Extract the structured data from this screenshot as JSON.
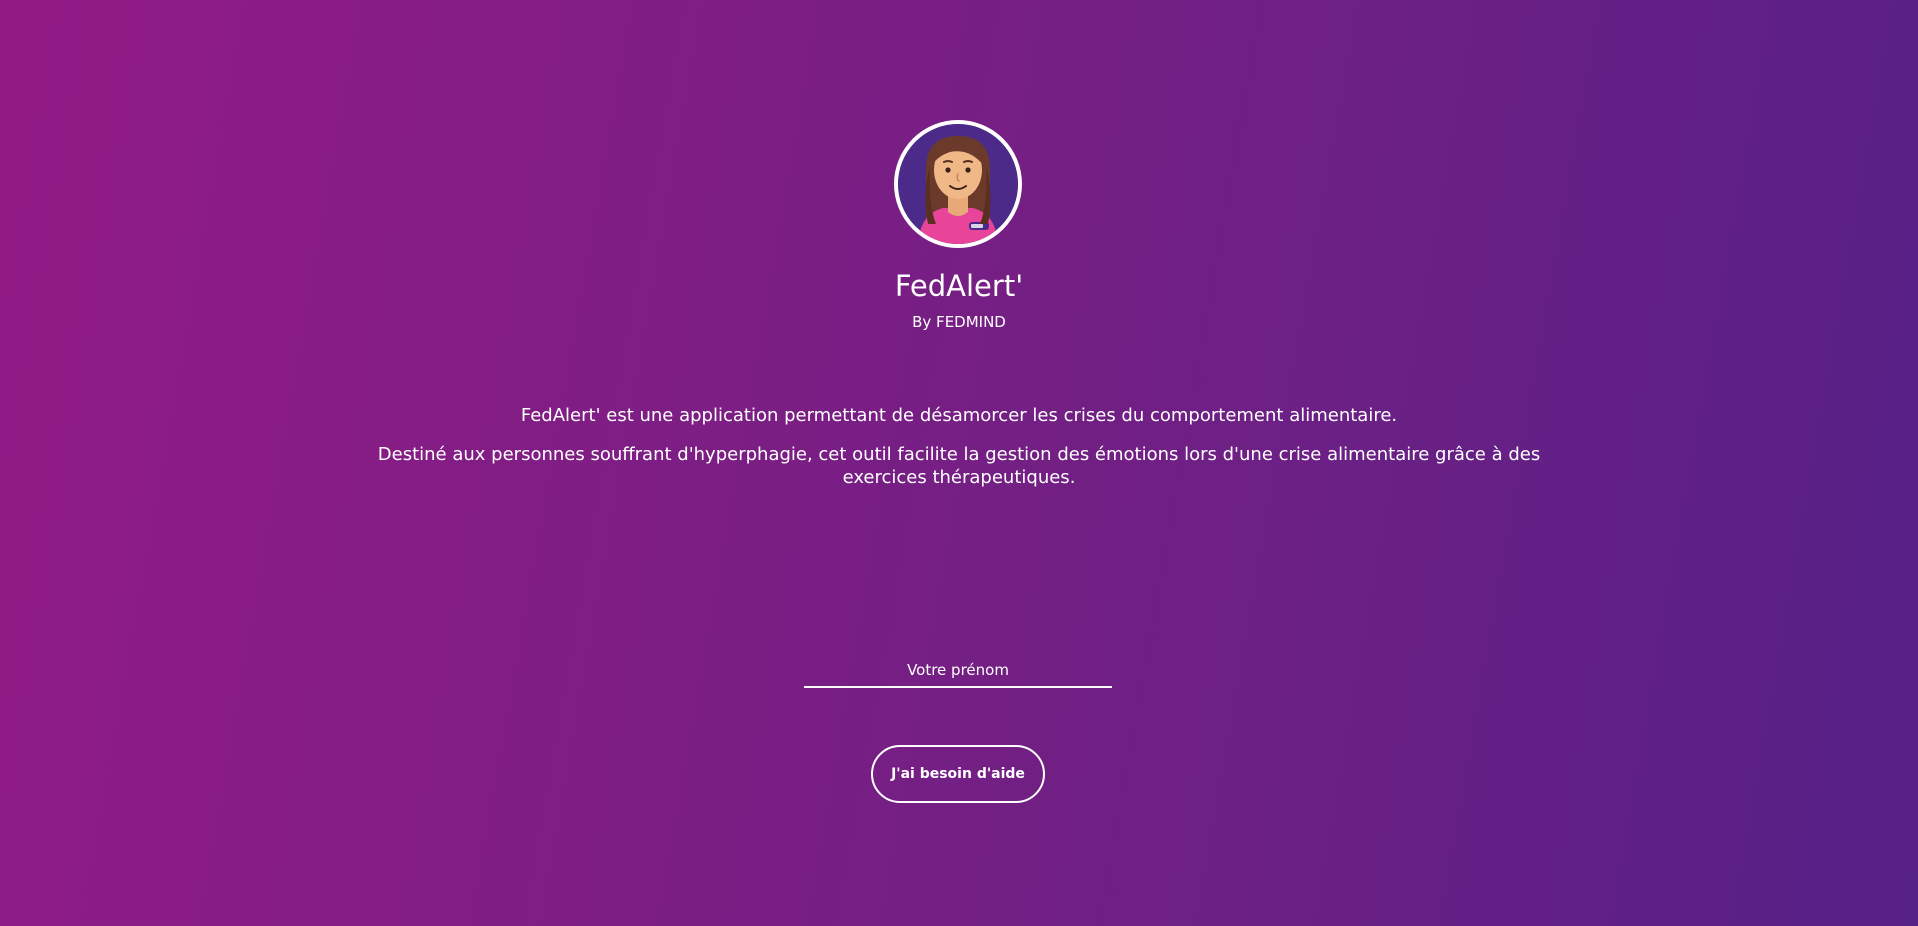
{
  "app": {
    "title": "FedAlert'",
    "subtitle": "By FEDMIND"
  },
  "description": {
    "line1": "FedAlert' est une application permettant de désamorcer les crises du comportement alimentaire.",
    "line2": "Destiné aux personnes souffrant d'hyperphagie, cet outil facilite la gestion des émotions lors d'une crise alimentaire grâce à des exercices thérapeutiques."
  },
  "form": {
    "name_placeholder": "Votre prénom",
    "name_value": ""
  },
  "actions": {
    "help_label": "J'ai besoin d'aide"
  },
  "avatar": {
    "icon": "woman-avatar-icon"
  },
  "colors": {
    "gradient_start": "#931b86",
    "gradient_end": "#552087",
    "text": "#ffffff"
  }
}
